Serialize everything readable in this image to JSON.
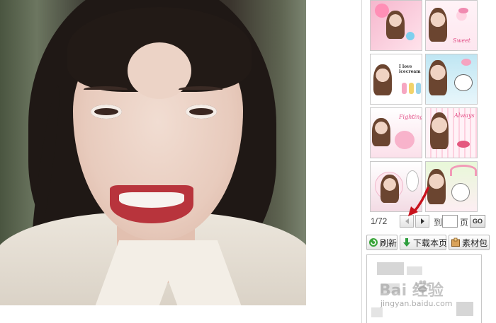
{
  "pager": {
    "page_count": "1/72",
    "goto_label": "到",
    "page_input_value": "",
    "page_label": "页",
    "go_label": "GO"
  },
  "actions": {
    "refresh_label": "刷新",
    "download_label": "下载本页",
    "material_label": "素材包"
  },
  "watermark": {
    "brand": "Bai 经验",
    "url": "jingyan.baidu.com"
  },
  "thumbnails": [
    {
      "theme": "pink-heart",
      "colors": [
        "#f7c7d8",
        "#ffe3ec"
      ]
    },
    {
      "theme": "pink-dots",
      "colors": [
        "#fde6ef",
        "#ffffff"
      ],
      "text": "Sweet"
    },
    {
      "theme": "i-love-icecream",
      "colors": [
        "#ffffff",
        "#fbe3ea"
      ],
      "text": "I love icecream"
    },
    {
      "theme": "blue-cute",
      "colors": [
        "#bfe6f3",
        "#e8f6fb"
      ]
    },
    {
      "theme": "pink-bunny",
      "colors": [
        "#fbe0ea",
        "#ffffff"
      ],
      "text": "Fighting"
    },
    {
      "theme": "pink-stripe",
      "colors": [
        "#fdd0df",
        "#fff2f7"
      ],
      "text": "Always"
    },
    {
      "theme": "white-bunny",
      "colors": [
        "#ffffff",
        "#f3dbe4"
      ]
    },
    {
      "theme": "rainbow",
      "colors": [
        "#e8f8d8",
        "#fdeef3"
      ]
    }
  ],
  "accent_colors": {
    "annotation_arrow": "#c8121c",
    "refresh_icon": "#3aa53a",
    "download_icon": "#2e9e3e"
  }
}
